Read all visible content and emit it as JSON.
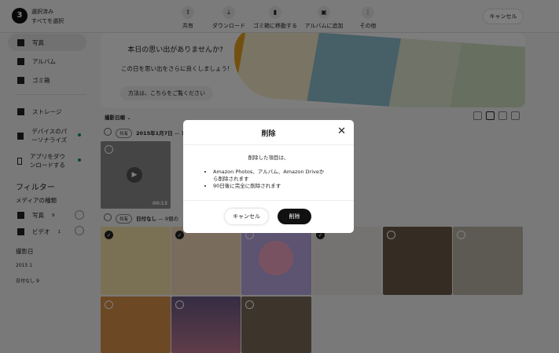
{
  "header": {
    "count": "3",
    "selected": "選択済み",
    "select_all": "すべてを選択",
    "actions": [
      {
        "label": "共有",
        "icon": "share-icon"
      },
      {
        "label": "ダウンロード",
        "icon": "download-icon"
      },
      {
        "label": "ゴミ箱に移動する",
        "icon": "trash-icon"
      },
      {
        "label": "アルバムに追加",
        "icon": "add-album-icon"
      },
      {
        "label": "その他",
        "icon": "more-icon"
      }
    ],
    "cancel": "キャンセル"
  },
  "sidebar": {
    "items": [
      {
        "label": "写真"
      },
      {
        "label": "アルバム"
      },
      {
        "label": "ゴミ箱"
      },
      {
        "label": "ストレージ"
      },
      {
        "label": "デバイスのパーソナライズ"
      },
      {
        "label": "アプリをダウンロードする"
      }
    ],
    "filter_title": "フィルター",
    "media_type": "メディアの種類",
    "photo": "写真",
    "photo_count": "9",
    "video": "ビデオ",
    "video_count": "1",
    "date_title": "撮影日",
    "year": "2015",
    "year_count": "1",
    "nodate": "日付なし",
    "nodate_count": "9"
  },
  "banner": {
    "title": "本日の思い出がありませんか?",
    "subtitle": "この日を思い出をさらに良くしましょう!",
    "button": "方法は、こちらをご覧ください"
  },
  "sort": "撮影日順",
  "groups": [
    {
      "share": "共有",
      "title": "2015年1月7日",
      "suffix": "— 1"
    },
    {
      "share": "共有",
      "title": "日付なし",
      "suffix": "— 9個の"
    }
  ],
  "video_duration": "00:13",
  "dialog": {
    "title": "削除",
    "intro": "削除した項目は、",
    "bullets": [
      "Amazon Photos、アルバム、Amazon Driveから削除されます",
      "90日後に完全に削除されます"
    ],
    "cancel": "キャンセル",
    "confirm": "削除"
  }
}
